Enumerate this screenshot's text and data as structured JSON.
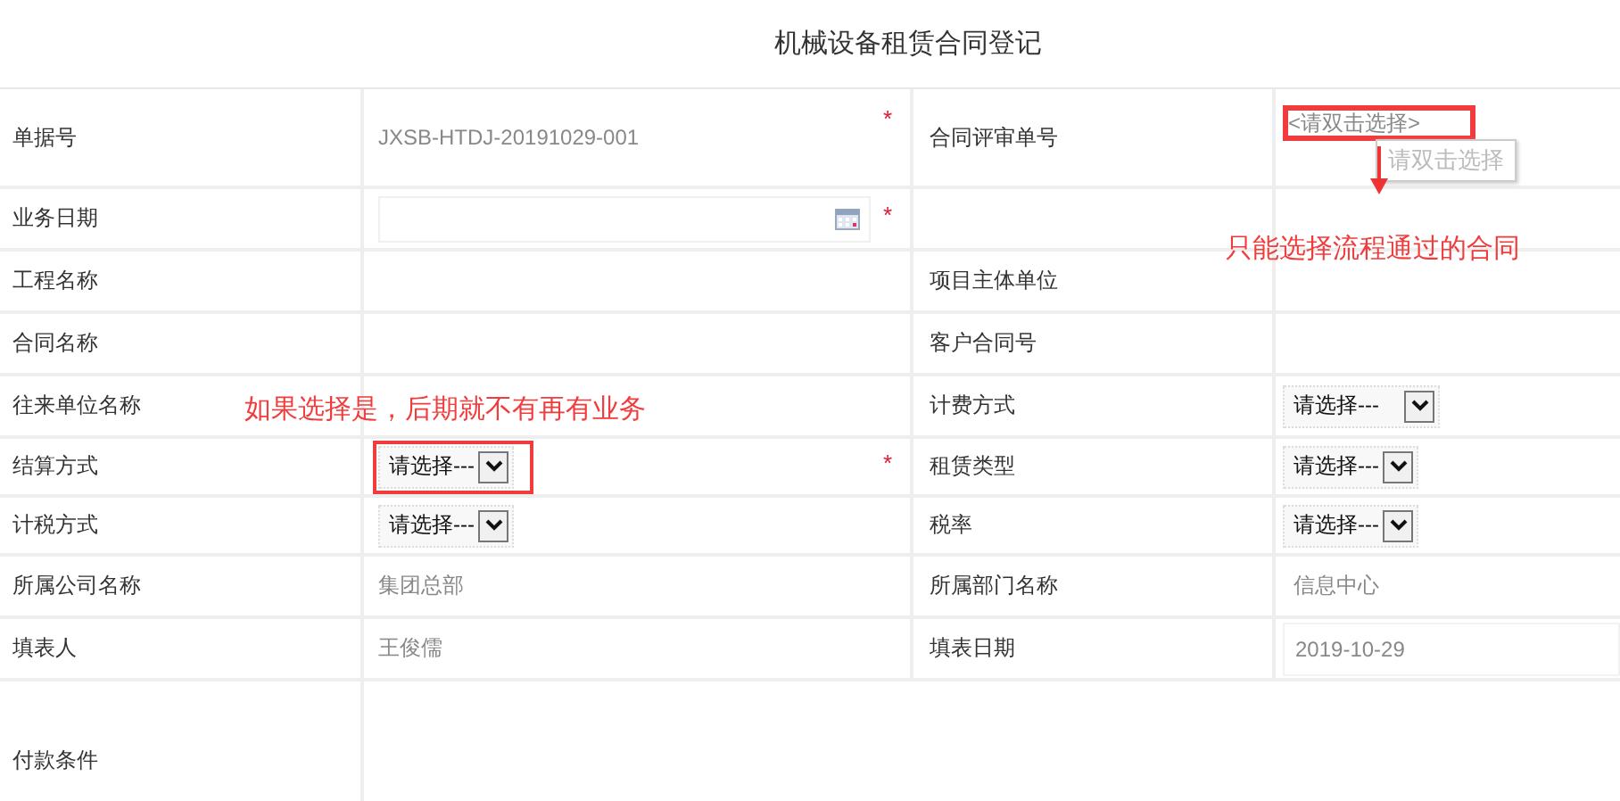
{
  "title": "机械设备租赁合同登记",
  "rows": [
    {
      "left": {
        "label": "单据号",
        "kind": "text",
        "value": "JXSB-HTDJ-20191029-001",
        "required_mark": "*"
      },
      "right": {
        "label": "合同评审单号",
        "kind": "lookup",
        "placeholder": "<请双击选择>",
        "highlighted": true,
        "tooltip": "请双击选择"
      }
    },
    {
      "left": {
        "label": "业务日期",
        "kind": "date",
        "required_mark": "*"
      },
      "right": {
        "kind": "empty"
      }
    },
    {
      "left": {
        "label": "工程名称",
        "kind": "text"
      },
      "right": {
        "label": "项目主体单位",
        "kind": "text"
      }
    },
    {
      "left": {
        "label": "合同名称",
        "kind": "text"
      },
      "right": {
        "label": "客户合同号",
        "kind": "text"
      }
    },
    {
      "left": {
        "label": "往来单位名称",
        "kind": "text"
      },
      "right": {
        "label": "计费方式",
        "kind": "select",
        "value": "请选择---",
        "highlighted": false
      }
    },
    {
      "left": {
        "label": "结算方式",
        "kind": "select",
        "value": "请选择---",
        "highlighted": true,
        "required_mark": "*"
      },
      "right": {
        "label": "租赁类型",
        "kind": "select",
        "value": "请选择---",
        "highlighted": false
      }
    },
    {
      "left": {
        "label": "计税方式",
        "kind": "select",
        "value": "请选择---",
        "highlighted": false
      },
      "right": {
        "label": "税率",
        "kind": "select",
        "value": "请选择---",
        "highlighted": false
      }
    },
    {
      "left": {
        "label": "所属公司名称",
        "kind": "text",
        "value": "集团总部"
      },
      "right": {
        "label": "所属部门名称",
        "kind": "text",
        "value": "信息中心"
      }
    },
    {
      "left": {
        "label": "填表人",
        "kind": "text",
        "value": "王俊儒"
      },
      "right": {
        "label": "填表日期",
        "kind": "input",
        "value": "2019-10-29"
      }
    },
    {
      "left": {
        "label": "付款条件",
        "kind": "text"
      }
    }
  ],
  "notes": [
    "只能选择流程通过的合同",
    "如果选择是，后期就不有再有业务"
  ]
}
